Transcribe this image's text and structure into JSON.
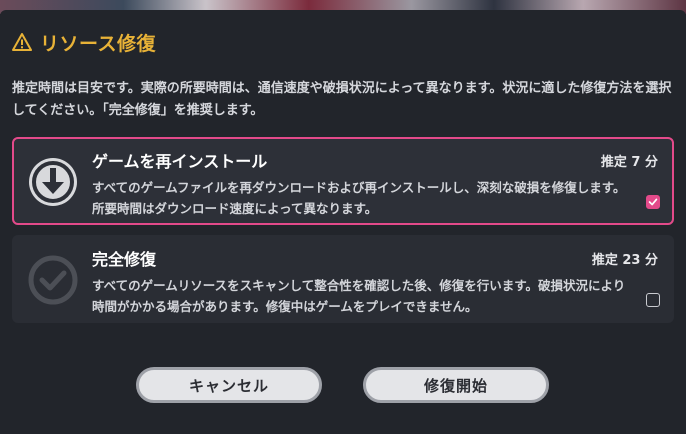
{
  "dialog": {
    "title": "リソース修復",
    "description": "推定時間は目安です。実際の所要時間は、通信速度や破損状況によって異なります。状況に適した修復方法を選択してください。「完全修復」を推奨します。"
  },
  "options": [
    {
      "title": "ゲームを再インストール",
      "estimate": "推定 7 分",
      "body": "すべてのゲームファイルを再ダウンロードおよび再インストールし、深刻な破損を修復します。所要時間はダウンロード速度によって異なります。",
      "selected": true,
      "icon": "download-arrow-icon"
    },
    {
      "title": "完全修復",
      "estimate": "推定 23 分",
      "body": "すべてのゲームリソースをスキャンして整合性を確認した後、修復を行います。破損状況により時間がかかる場合があります。修復中はゲームをプレイできません。",
      "selected": false,
      "icon": "check-circle-icon"
    }
  ],
  "buttons": {
    "cancel": "キャンセル",
    "start": "修復開始"
  },
  "colors": {
    "accent": "#e34a8a",
    "title": "#e8b237"
  }
}
